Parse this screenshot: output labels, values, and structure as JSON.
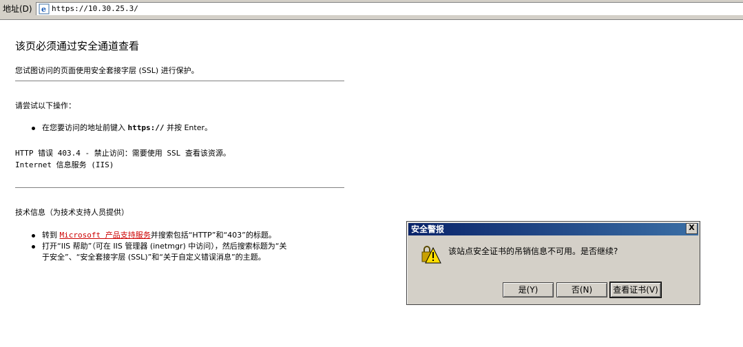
{
  "address_bar": {
    "label": "地址(D)",
    "url": "https://10.30.25.3/"
  },
  "page": {
    "title": "该页必须通过安全通道查看",
    "ssl_notice": "您试图访问的页面使用安全套接字层 (SSL) 进行保护。",
    "try_heading": "请尝试以下操作：",
    "try_items": [
      {
        "prefix": "在您要访问的地址前键入 ",
        "bold": "https://",
        "suffix": " 并按 Enter。"
      }
    ],
    "error_line": "HTTP 错误 403.4 - 禁止访问：需要使用 SSL 查看该资源。",
    "server_line": "Internet 信息服务 (IIS)",
    "tech_heading": "技术信息（为技术支持人员提供）",
    "tech_items": [
      {
        "prefix": "转到 ",
        "link": "Microsoft 产品支持服务",
        "suffix": "并搜索包括“HTTP”和“403”的标题。"
      },
      {
        "line1": "打开“IIS 帮助”（可在 IIS 管理器 (inetmgr) 中访问），然后搜索标题为“关",
        "line2": "于安全”、“安全套接字层 (SSL)”和“关于自定义错误消息”的主题。"
      }
    ]
  },
  "dialog": {
    "title": "安全警报",
    "close": "X",
    "message": "该站点安全证书的吊销信息不可用。是否继续?",
    "buttons": {
      "yes": "是(Y)",
      "no": "否(N)",
      "view": "查看证书(V)"
    }
  }
}
